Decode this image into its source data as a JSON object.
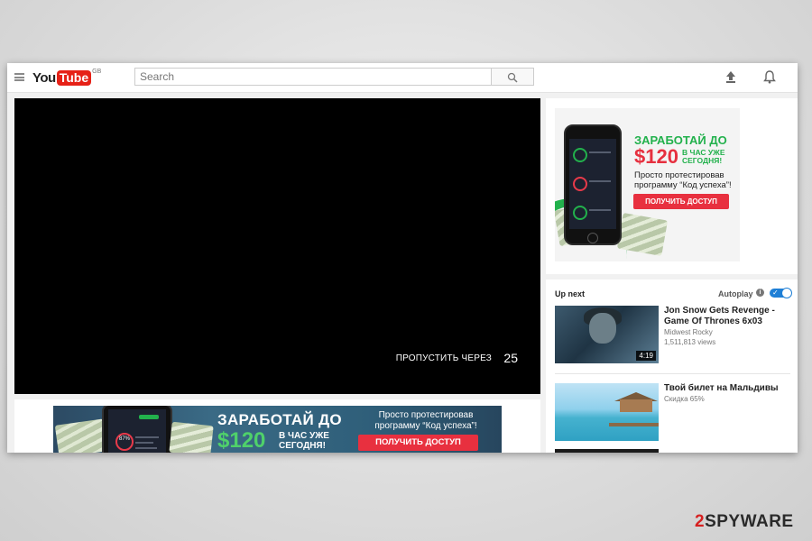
{
  "header": {
    "logo_you": "You",
    "logo_tube": "Tube",
    "logo_country": "GB",
    "search_placeholder": "Search"
  },
  "player": {
    "skip_text": "ПРОПУСТИТЬ ЧЕРЕЗ",
    "skip_count": "25"
  },
  "banner": {
    "title": "ЗАРАБОТАЙ ДО",
    "price": "$120",
    "sub": "В ЧАС УЖЕ СЕГОДНЯ!",
    "desc": "Просто протестировав программу “Код успеха”!",
    "cta": "ПОЛУЧИТЬ ДОСТУП",
    "phone_pct": "87%"
  },
  "side_ad": {
    "title": "ЗАРАБОТАЙ ДО",
    "price": "$120",
    "sub": "В ЧАС УЖЕ СЕГОДНЯ!",
    "desc": "Просто протестировав программу “Код успеха”!",
    "cta": "ПОЛУЧИТЬ ДОСТУП"
  },
  "upnext": {
    "label": "Up next",
    "autoplay_label": "Autoplay",
    "autoplay_on": true,
    "videos": [
      {
        "title": "Jon Snow Gets Revenge - Game Of Thrones 6x03",
        "channel": "Midwest Rocky",
        "views": "1,511,813 views",
        "duration": "4:19"
      },
      {
        "title": "Твой билет на Мальдивы",
        "channel": "Скидка 65%"
      }
    ]
  },
  "watermark": {
    "num": "2",
    "text": "SPYWARE"
  },
  "colors": {
    "brand_red": "#e62117",
    "ad_green": "#22b14c",
    "cta_red": "#e8303f",
    "toggle_blue": "#1e7fd6"
  }
}
